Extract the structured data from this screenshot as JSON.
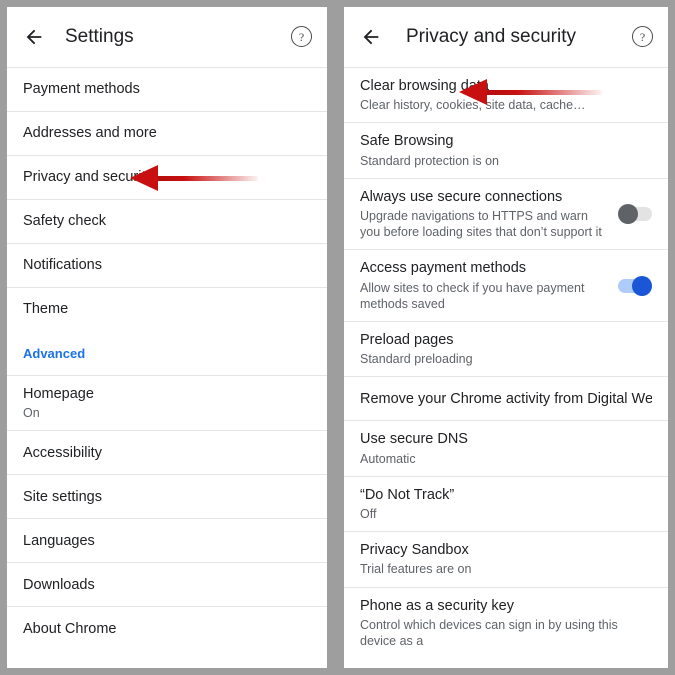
{
  "left_panel": {
    "appbar": {
      "back_icon": "arrow-left-icon",
      "title": "Settings",
      "help_icon": "help-circle-icon",
      "help_glyph": "?"
    },
    "items": [
      {
        "type": "item",
        "title": "Payment methods"
      },
      {
        "type": "item",
        "title": "Addresses and more"
      },
      {
        "type": "item",
        "title": "Privacy and security"
      },
      {
        "type": "item",
        "title": "Safety check"
      },
      {
        "type": "item",
        "title": "Notifications"
      },
      {
        "type": "item",
        "title": "Theme"
      },
      {
        "type": "section",
        "title": "Advanced"
      },
      {
        "type": "item",
        "title": "Homepage",
        "subtitle": "On"
      },
      {
        "type": "item",
        "title": "Accessibility"
      },
      {
        "type": "item",
        "title": "Site settings"
      },
      {
        "type": "item",
        "title": "Languages"
      },
      {
        "type": "item",
        "title": "Downloads"
      },
      {
        "type": "item",
        "title": "About Chrome"
      }
    ]
  },
  "right_panel": {
    "appbar": {
      "back_icon": "arrow-left-icon",
      "title": "Privacy and security",
      "help_icon": "help-circle-icon",
      "help_glyph": "?"
    },
    "items": [
      {
        "type": "item",
        "title": "Clear browsing data",
        "subtitle": "Clear history, cookies, site data, cache…"
      },
      {
        "type": "item",
        "title": "Safe Browsing",
        "subtitle": "Standard protection is on"
      },
      {
        "type": "toggle",
        "title": "Always use secure connections",
        "subtitle": "Upgrade navigations to HTTPS and warn you before loading sites that don’t support it",
        "state": "off"
      },
      {
        "type": "toggle",
        "title": "Access payment methods",
        "subtitle": "Allow sites to check if you have payment methods saved",
        "state": "on"
      },
      {
        "type": "item",
        "title": "Preload pages",
        "subtitle": "Standard preloading"
      },
      {
        "type": "item",
        "title": "Remove your Chrome activity from Digital Wellbeing"
      },
      {
        "type": "item",
        "title": "Use secure DNS",
        "subtitle": "Automatic"
      },
      {
        "type": "item",
        "title": "“Do Not Track”",
        "subtitle": "Off"
      },
      {
        "type": "item",
        "title": "Privacy Sandbox",
        "subtitle": "Trial features are on"
      },
      {
        "type": "item",
        "title": "Phone as a security key",
        "subtitle": "Control which devices can sign in by using this device as a"
      }
    ]
  },
  "annotations": {
    "arrow_color": "#c81010",
    "arrow_left": {
      "name": "arrow-pointing-to-privacy-and-security"
    },
    "arrow_right": {
      "name": "arrow-pointing-to-clear-browsing-data"
    }
  },
  "colors": {
    "accent_blue": "#1a73e8",
    "toggle_on": "#1a56d6",
    "toggle_off_knob": "#5f6368",
    "background": "#9e9e9e",
    "text_primary": "#202124",
    "text_secondary": "#5f6368"
  }
}
